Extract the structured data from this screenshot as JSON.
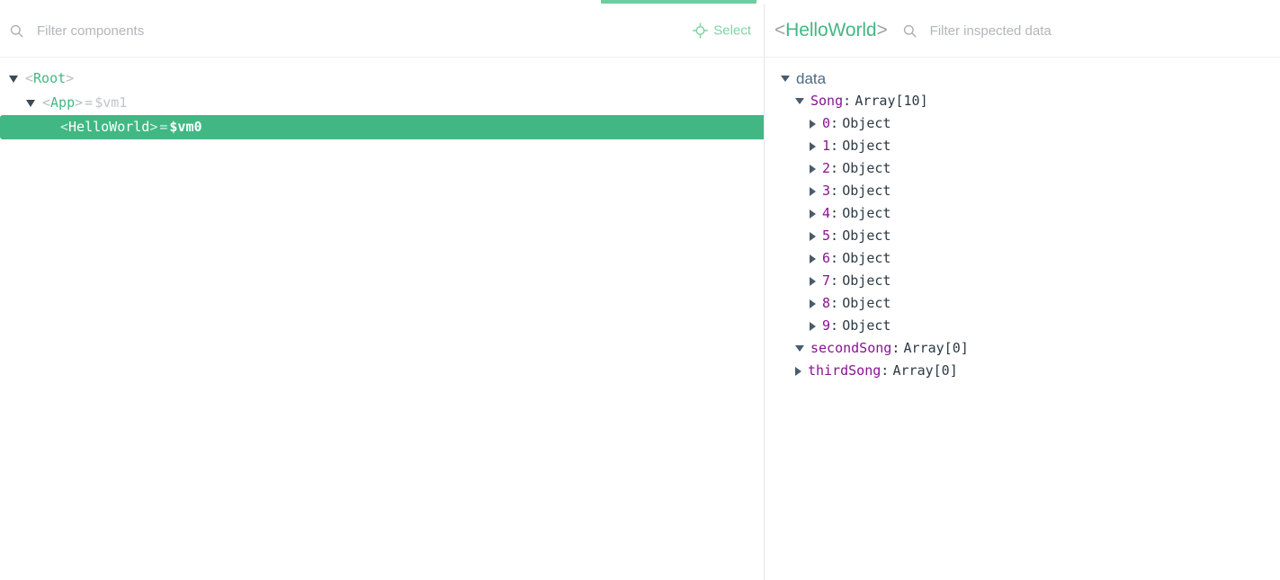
{
  "window": {
    "title": "Vue Devtools — Components",
    "accent_green": "#41b883",
    "tab_indicator_green": "#6ccda0",
    "key_purple": "#881391",
    "group_label_blue": "#4b6a85"
  },
  "tabstrip": {
    "active_tab_name": "components-tab"
  },
  "components_panel": {
    "search": {
      "icon": "search-icon",
      "placeholder": "Filter components",
      "value": ""
    },
    "select_button": {
      "icon": "crosshair-icon",
      "label": "Select"
    },
    "tree": [
      {
        "arrow": "down",
        "open_angle": "<",
        "name": "Root",
        "close_angle": ">",
        "eq": "",
        "vm": "",
        "indent": 0,
        "selected": false
      },
      {
        "arrow": "down",
        "open_angle": "<",
        "name": "App",
        "close_angle": ">",
        "eq": "=",
        "vm": "$vm1",
        "indent": 1,
        "selected": false
      },
      {
        "arrow": "none",
        "open_angle": "<",
        "name": "HelloWorld",
        "close_angle": ">",
        "eq": "=",
        "vm": "$vm0",
        "indent": 2,
        "selected": true
      }
    ]
  },
  "inspector_panel": {
    "header": {
      "open_angle": "<",
      "component_name": "HelloWorld",
      "close_angle": ">"
    },
    "search": {
      "icon": "search-icon",
      "placeholder": "Filter inspected data",
      "value": ""
    },
    "groups": [
      {
        "label": "data",
        "arrow": "down"
      }
    ],
    "rows": [
      {
        "arrow": "down",
        "key": "Song",
        "colon": ":",
        "value": "Array[10]",
        "indent": 1
      },
      {
        "arrow": "right",
        "key": "0",
        "colon": ":",
        "value": "Object",
        "indent": 2
      },
      {
        "arrow": "right",
        "key": "1",
        "colon": ":",
        "value": "Object",
        "indent": 2
      },
      {
        "arrow": "right",
        "key": "2",
        "colon": ":",
        "value": "Object",
        "indent": 2
      },
      {
        "arrow": "right",
        "key": "3",
        "colon": ":",
        "value": "Object",
        "indent": 2
      },
      {
        "arrow": "right",
        "key": "4",
        "colon": ":",
        "value": "Object",
        "indent": 2
      },
      {
        "arrow": "right",
        "key": "5",
        "colon": ":",
        "value": "Object",
        "indent": 2
      },
      {
        "arrow": "right",
        "key": "6",
        "colon": ":",
        "value": "Object",
        "indent": 2
      },
      {
        "arrow": "right",
        "key": "7",
        "colon": ":",
        "value": "Object",
        "indent": 2
      },
      {
        "arrow": "right",
        "key": "8",
        "colon": ":",
        "value": "Object",
        "indent": 2
      },
      {
        "arrow": "right",
        "key": "9",
        "colon": ":",
        "value": "Object",
        "indent": 2
      },
      {
        "arrow": "down",
        "key": "secondSong",
        "colon": ":",
        "value": "Array[0]",
        "indent": 1
      },
      {
        "arrow": "right",
        "key": "thirdSong",
        "colon": ":",
        "value": "Array[0]",
        "indent": 1
      }
    ]
  }
}
